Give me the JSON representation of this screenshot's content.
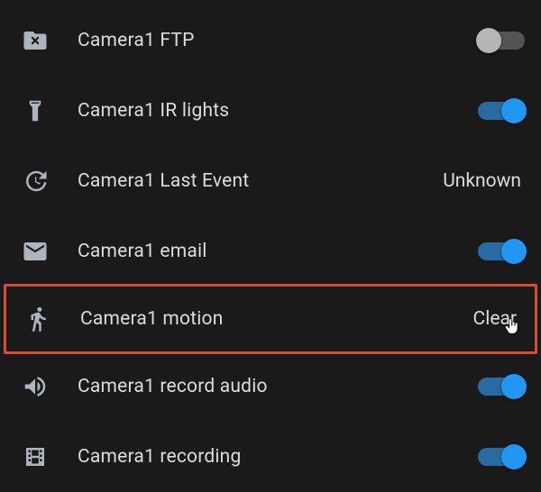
{
  "rows": [
    {
      "id": "ftp",
      "icon": "folder-remove-icon",
      "label": "Camera1 FTP",
      "control": {
        "type": "switch",
        "state": "off"
      }
    },
    {
      "id": "ir",
      "icon": "flashlight-icon",
      "label": "Camera1 IR lights",
      "control": {
        "type": "switch",
        "state": "on"
      }
    },
    {
      "id": "last-event",
      "icon": "history-icon",
      "label": "Camera1 Last Event",
      "control": {
        "type": "value",
        "text": "Unknown"
      }
    },
    {
      "id": "email",
      "icon": "email-icon",
      "label": "Camera1 email",
      "control": {
        "type": "switch",
        "state": "on"
      }
    },
    {
      "id": "motion",
      "icon": "walk-icon",
      "label": "Camera1 motion",
      "control": {
        "type": "action",
        "text": "Clear"
      },
      "highlighted": true,
      "cursor": true
    },
    {
      "id": "record-audio",
      "icon": "volume-icon",
      "label": "Camera1 record audio",
      "control": {
        "type": "switch",
        "state": "on"
      }
    },
    {
      "id": "recording",
      "icon": "film-icon",
      "label": "Camera1 recording",
      "control": {
        "type": "switch",
        "state": "on"
      }
    }
  ],
  "colors": {
    "background": "#1a1a1a",
    "switch_on_thumb": "#2196f3",
    "switch_on_track": "#2a6aa3",
    "switch_off_thumb": "#b6b6b6",
    "switch_off_track": "#545454",
    "highlight_border": "#d94b32",
    "icon": "#aeb4bb",
    "text": "#dcdcdc"
  }
}
